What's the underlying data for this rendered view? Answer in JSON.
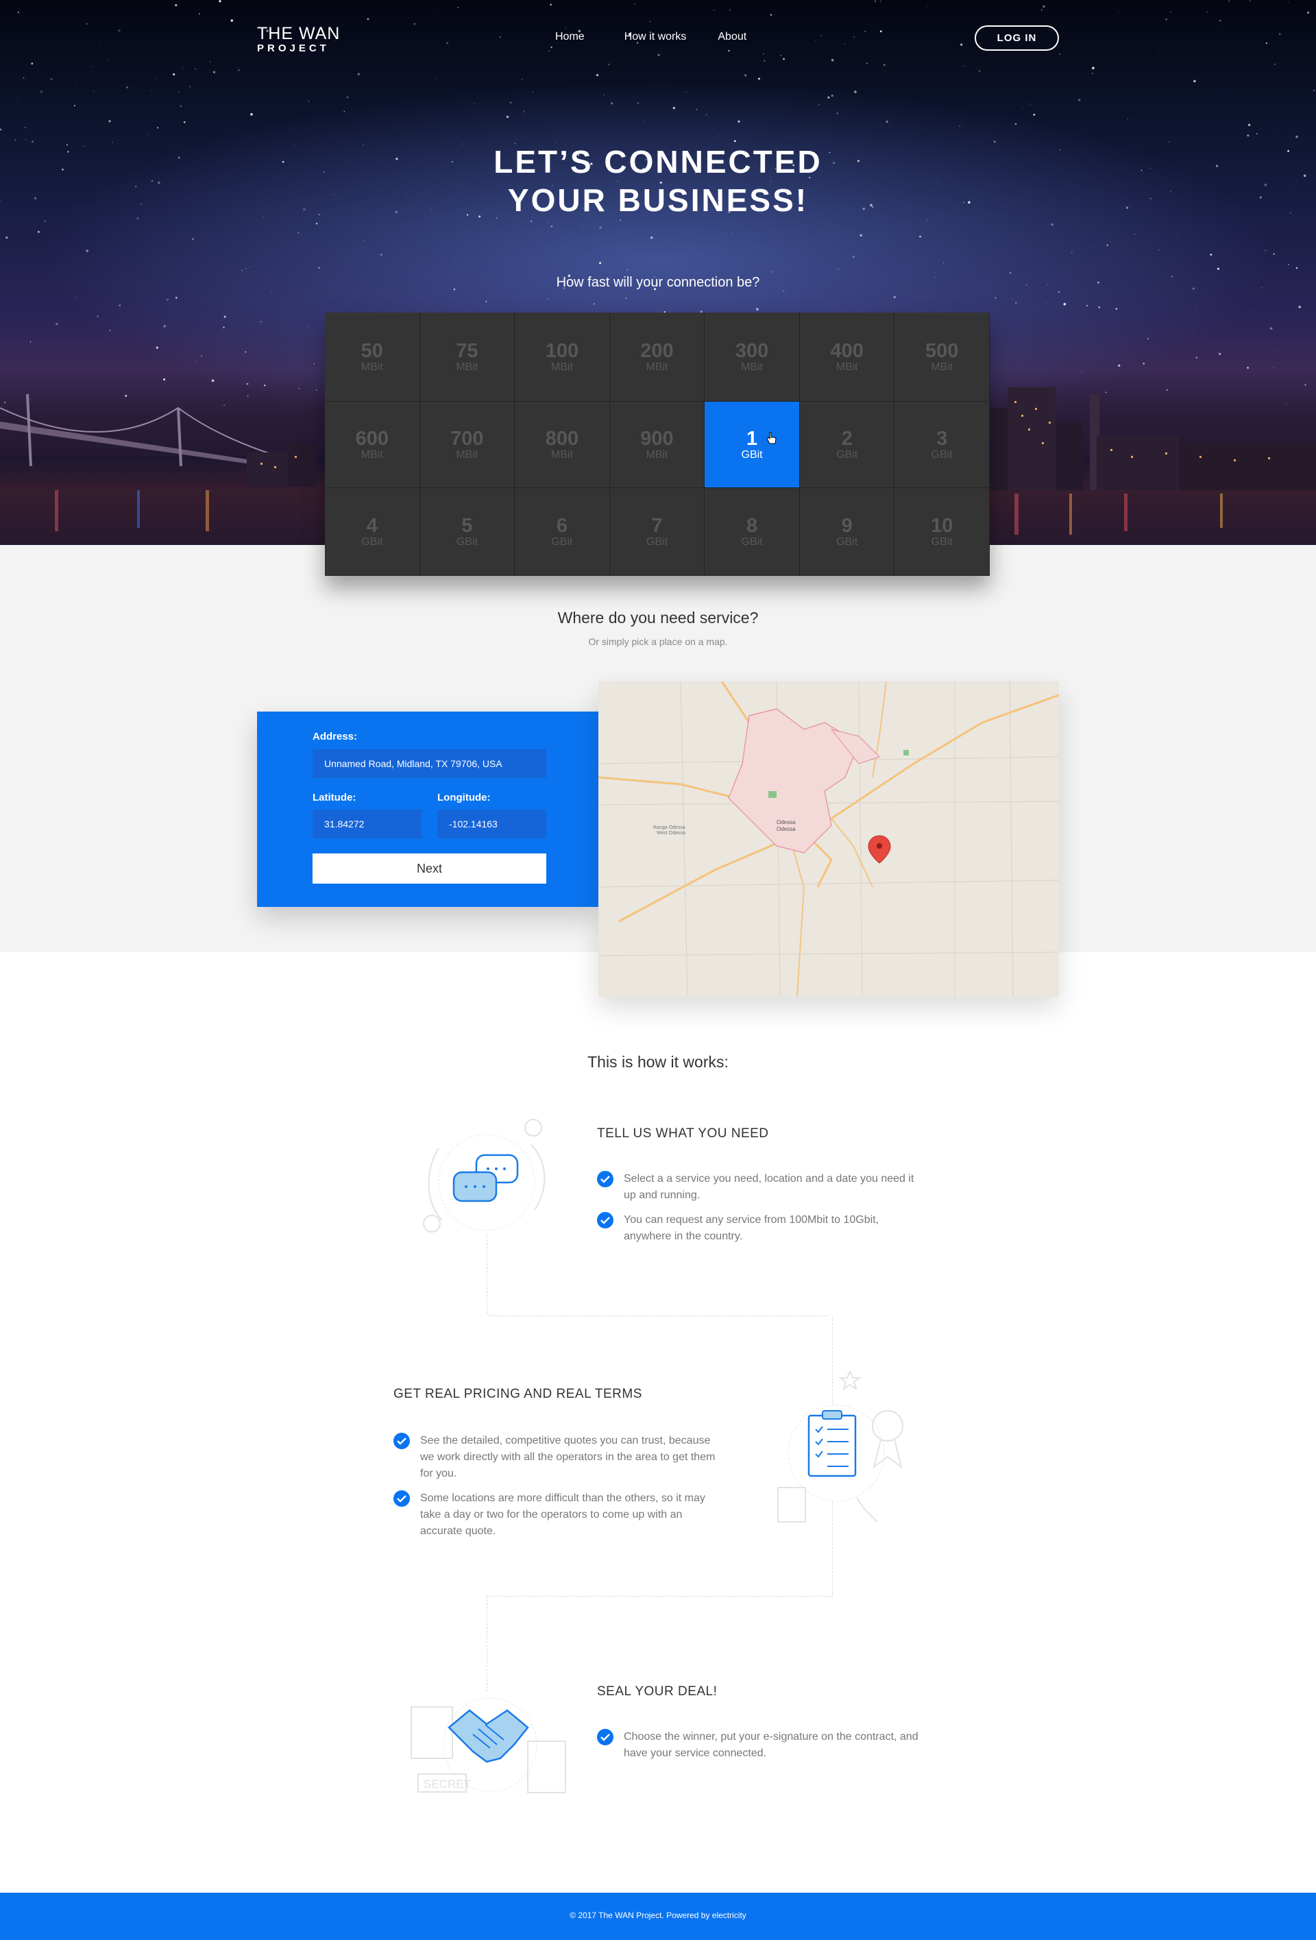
{
  "nav": {
    "logo_top": "THE WAN",
    "logo_bottom": "PROJECT",
    "links": [
      "Home",
      "How it works",
      "About"
    ],
    "login_label": "LOG IN"
  },
  "hero": {
    "title_line1": "LET’S CONNECTED",
    "title_line2": "YOUR BUSINESS!",
    "subtitle": "How fast will your connection be?"
  },
  "speeds": [
    {
      "num": "50",
      "unit": "MBit"
    },
    {
      "num": "75",
      "unit": "MBit"
    },
    {
      "num": "100",
      "unit": "MBit"
    },
    {
      "num": "200",
      "unit": "MBit"
    },
    {
      "num": "300",
      "unit": "MBit"
    },
    {
      "num": "400",
      "unit": "MBit"
    },
    {
      "num": "500",
      "unit": "MBit"
    },
    {
      "num": "600",
      "unit": "MBit"
    },
    {
      "num": "700",
      "unit": "MBit"
    },
    {
      "num": "800",
      "unit": "MBit"
    },
    {
      "num": "900",
      "unit": "MBit"
    },
    {
      "num": "1",
      "unit": "GBit",
      "selected": true
    },
    {
      "num": "2",
      "unit": "GBit"
    },
    {
      "num": "3",
      "unit": "GBit"
    },
    {
      "num": "4",
      "unit": "GBit"
    },
    {
      "num": "5",
      "unit": "GBit"
    },
    {
      "num": "6",
      "unit": "GBit"
    },
    {
      "num": "7",
      "unit": "GBit"
    },
    {
      "num": "8",
      "unit": "GBit"
    },
    {
      "num": "9",
      "unit": "GBit"
    },
    {
      "num": "10",
      "unit": "GBit"
    }
  ],
  "service": {
    "title": "Where do you need service?",
    "subtitle": "Or simply pick a place on a map.",
    "address_label": "Address:",
    "address_value": "Unnamed Road, Midland, TX 79706, USA",
    "latitude_label": "Latitude:",
    "latitude_value": "31.84272",
    "longitude_label": "Longitude:",
    "longitude_value": "-102.14163",
    "next_label": "Next"
  },
  "map": {
    "city_label_1": "Odessa",
    "city_label_2": "Odessa",
    "west_label_1": "Ranga Odessa",
    "west_label_2": "West Odessa"
  },
  "how": {
    "title": "This is how it works:",
    "steps": [
      {
        "title": "TELL US WHAT YOU NEED",
        "bullets": [
          "Select a a service you need, location and a date you need it up and running.",
          "You can request any service from 100Mbit to 10Gbit, anywhere in the country."
        ]
      },
      {
        "title": "GET REAL PRICING AND REAL TERMS",
        "bullets": [
          "See the detailed, competitive quotes you can trust, because we work directly with all the operators in the area to get them for you.",
          "Some locations are more difficult than the others, so it may take a day or two for the operators to come up with an accurate quote."
        ]
      },
      {
        "title": "SEAL YOUR DEAL!",
        "bullets": [
          "Choose the winner, put your e-signature on the contract, and have your service connected."
        ]
      }
    ],
    "secret_stamp": "SECRET"
  },
  "footer": {
    "text": "© 2017  The WAN Project. Powered by electricity"
  },
  "colors": {
    "accent": "#0a74f0",
    "grid_bg": "#343434",
    "light_bg": "#f3f3f3"
  }
}
